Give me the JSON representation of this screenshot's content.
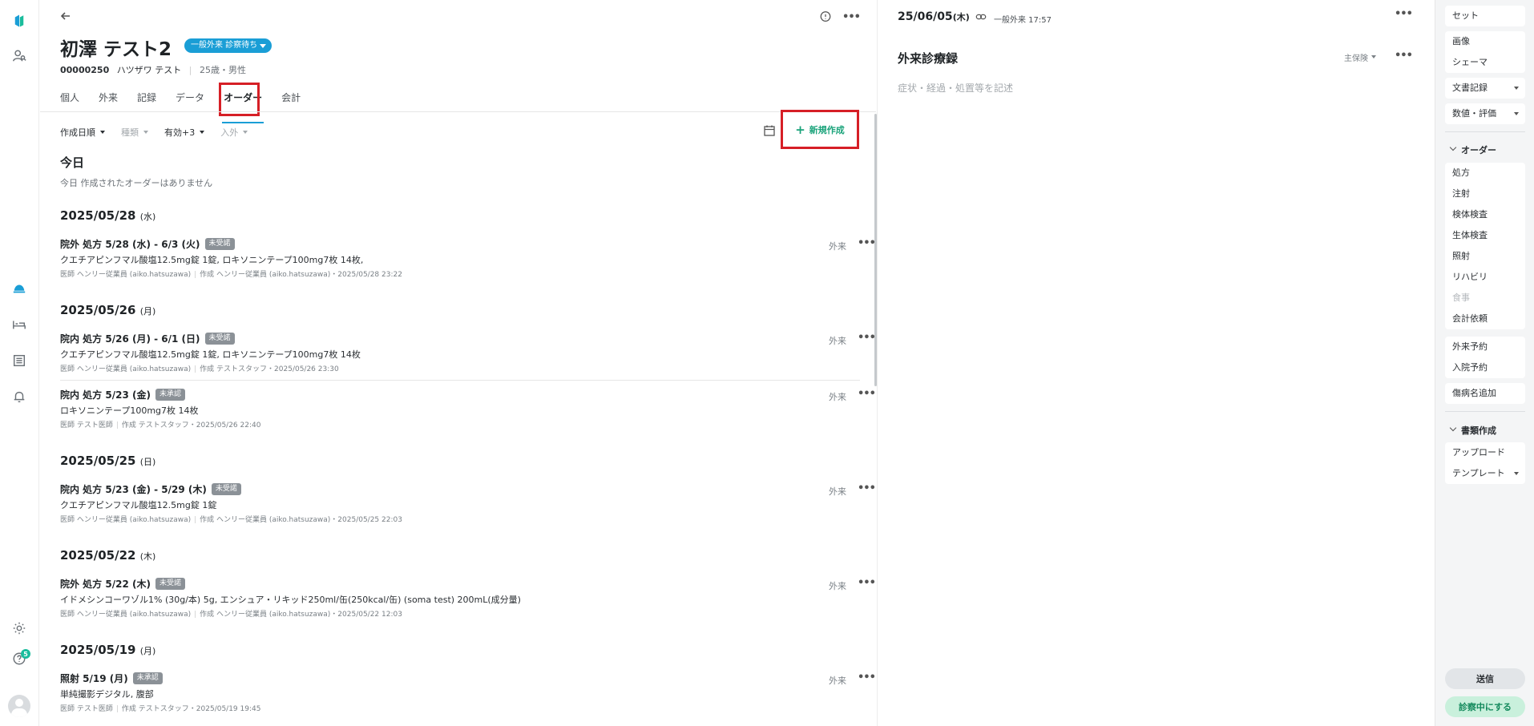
{
  "patient": {
    "name": "初澤 テスト2",
    "status": "一般外来 診察待ち",
    "id": "00000250",
    "kana": "ハツザワ テスト",
    "age_sex": "25歳・男性"
  },
  "tabs": [
    "個人",
    "外来",
    "記録",
    "データ",
    "オーダー",
    "会計"
  ],
  "active_tab": "オーダー",
  "filters": {
    "sort": "作成日順",
    "category": "種類",
    "validity": "有効+3",
    "inout": "入外"
  },
  "new_button": "新規作成",
  "sections": [
    {
      "date": "今日",
      "weekday": "",
      "empty": "今日 作成されたオーダーはありません",
      "orders": []
    },
    {
      "date": "2025/05/28",
      "weekday": "(水)",
      "orders": [
        {
          "title": "院外 処方  5/28 (水) - 6/3 (火)",
          "tag": "未受諾",
          "desc": "クエチアピンフマル酸塩12.5mg錠 1錠, ロキソニンテープ100mg7枚 14枚,",
          "doctor": "医師 ヘンリー従業員 (aiko.hatsuzawa)",
          "created": "作成 ヘンリー従業員 (aiko.hatsuzawa)・2025/05/28 23:22",
          "kind": "外来"
        }
      ]
    },
    {
      "date": "2025/05/26",
      "weekday": "(月)",
      "orders": [
        {
          "title": "院内 処方  5/26 (月) - 6/1 (日)",
          "tag": "未受諾",
          "desc": "クエチアピンフマル酸塩12.5mg錠 1錠, ロキソニンテープ100mg7枚 14枚",
          "doctor": "医師 ヘンリー従業員 (aiko.hatsuzawa)",
          "created": "作成 テストスタッフ・2025/05/26 23:30",
          "kind": "外来"
        },
        {
          "title": "院内 処方  5/23 (金)",
          "tag": "未承認",
          "desc": "ロキソニンテープ100mg7枚 14枚",
          "doctor": "医師 テスト医師",
          "created": "作成 テストスタッフ・2025/05/26 22:40",
          "kind": "外来"
        }
      ]
    },
    {
      "date": "2025/05/25",
      "weekday": "(日)",
      "orders": [
        {
          "title": "院内 処方  5/23 (金) - 5/29 (木)",
          "tag": "未受諾",
          "desc": "クエチアピンフマル酸塩12.5mg錠 1錠",
          "doctor": "医師 ヘンリー従業員 (aiko.hatsuzawa)",
          "created": "作成 ヘンリー従業員 (aiko.hatsuzawa)・2025/05/25 22:03",
          "kind": "外来"
        }
      ]
    },
    {
      "date": "2025/05/22",
      "weekday": "(木)",
      "orders": [
        {
          "title": "院外 処方  5/22 (木)",
          "tag": "未受諾",
          "desc": "イドメシンコーワゾル1% (30g/本) 5g, エンシュア・リキッド250ml/缶(250kcal/缶) (soma test) 200mL(成分量)",
          "doctor": "医師 ヘンリー従業員 (aiko.hatsuzawa)",
          "created": "作成 ヘンリー従業員 (aiko.hatsuzawa)・2025/05/22 12:03",
          "kind": "外来"
        }
      ]
    },
    {
      "date": "2025/05/19",
      "weekday": "(月)",
      "orders": [
        {
          "title": "照射  5/19 (月)",
          "tag": "未承認",
          "desc": "単純撮影デジタル, 腹部",
          "doctor": "医師 テスト医師",
          "created": "作成 テストスタッフ・2025/05/19 19:45",
          "kind": "外来"
        }
      ]
    }
  ],
  "record": {
    "date": "25/06/05",
    "weekday": "(木)",
    "type": "一般外来 17:57",
    "title": "外来診療録",
    "insurance": "主保険",
    "placeholder": "症状・経過・処置等を記述"
  },
  "sidebar": {
    "group1": [
      "セット"
    ],
    "group2": [
      "画像",
      "シェーマ"
    ],
    "group3": [
      "文書記録"
    ],
    "group4": [
      "数値・評価"
    ],
    "order_section": "オーダー",
    "orders_group": [
      "処方",
      "注射",
      "検体検査",
      "生体検査",
      "照射",
      "リハビリ",
      "食事",
      "会計依頼"
    ],
    "reserve_group": [
      "外来予約",
      "入院予約"
    ],
    "disease_group": [
      "傷病名追加"
    ],
    "docs_section": "書類作成",
    "docs_group": [
      "アップロード",
      "テンプレート"
    ],
    "send": "送信",
    "exam": "診察中にする"
  },
  "notifications_count": "5"
}
